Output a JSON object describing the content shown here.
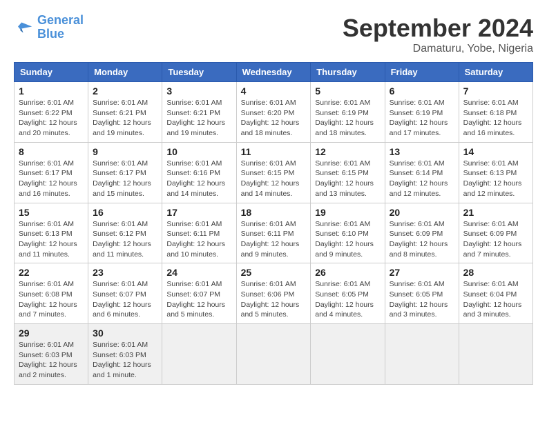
{
  "logo": {
    "line1": "General",
    "line2": "Blue"
  },
  "title": "September 2024",
  "subtitle": "Damaturu, Yobe, Nigeria",
  "weekdays": [
    "Sunday",
    "Monday",
    "Tuesday",
    "Wednesday",
    "Thursday",
    "Friday",
    "Saturday"
  ],
  "weeks": [
    [
      {
        "day": "1",
        "sunrise": "6:01 AM",
        "sunset": "6:22 PM",
        "daylight": "12 hours and 20 minutes."
      },
      {
        "day": "2",
        "sunrise": "6:01 AM",
        "sunset": "6:21 PM",
        "daylight": "12 hours and 19 minutes."
      },
      {
        "day": "3",
        "sunrise": "6:01 AM",
        "sunset": "6:21 PM",
        "daylight": "12 hours and 19 minutes."
      },
      {
        "day": "4",
        "sunrise": "6:01 AM",
        "sunset": "6:20 PM",
        "daylight": "12 hours and 18 minutes."
      },
      {
        "day": "5",
        "sunrise": "6:01 AM",
        "sunset": "6:19 PM",
        "daylight": "12 hours and 18 minutes."
      },
      {
        "day": "6",
        "sunrise": "6:01 AM",
        "sunset": "6:19 PM",
        "daylight": "12 hours and 17 minutes."
      },
      {
        "day": "7",
        "sunrise": "6:01 AM",
        "sunset": "6:18 PM",
        "daylight": "12 hours and 16 minutes."
      }
    ],
    [
      {
        "day": "8",
        "sunrise": "6:01 AM",
        "sunset": "6:17 PM",
        "daylight": "12 hours and 16 minutes."
      },
      {
        "day": "9",
        "sunrise": "6:01 AM",
        "sunset": "6:17 PM",
        "daylight": "12 hours and 15 minutes."
      },
      {
        "day": "10",
        "sunrise": "6:01 AM",
        "sunset": "6:16 PM",
        "daylight": "12 hours and 14 minutes."
      },
      {
        "day": "11",
        "sunrise": "6:01 AM",
        "sunset": "6:15 PM",
        "daylight": "12 hours and 14 minutes."
      },
      {
        "day": "12",
        "sunrise": "6:01 AM",
        "sunset": "6:15 PM",
        "daylight": "12 hours and 13 minutes."
      },
      {
        "day": "13",
        "sunrise": "6:01 AM",
        "sunset": "6:14 PM",
        "daylight": "12 hours and 12 minutes."
      },
      {
        "day": "14",
        "sunrise": "6:01 AM",
        "sunset": "6:13 PM",
        "daylight": "12 hours and 12 minutes."
      }
    ],
    [
      {
        "day": "15",
        "sunrise": "6:01 AM",
        "sunset": "6:13 PM",
        "daylight": "12 hours and 11 minutes."
      },
      {
        "day": "16",
        "sunrise": "6:01 AM",
        "sunset": "6:12 PM",
        "daylight": "12 hours and 11 minutes."
      },
      {
        "day": "17",
        "sunrise": "6:01 AM",
        "sunset": "6:11 PM",
        "daylight": "12 hours and 10 minutes."
      },
      {
        "day": "18",
        "sunrise": "6:01 AM",
        "sunset": "6:11 PM",
        "daylight": "12 hours and 9 minutes."
      },
      {
        "day": "19",
        "sunrise": "6:01 AM",
        "sunset": "6:10 PM",
        "daylight": "12 hours and 9 minutes."
      },
      {
        "day": "20",
        "sunrise": "6:01 AM",
        "sunset": "6:09 PM",
        "daylight": "12 hours and 8 minutes."
      },
      {
        "day": "21",
        "sunrise": "6:01 AM",
        "sunset": "6:09 PM",
        "daylight": "12 hours and 7 minutes."
      }
    ],
    [
      {
        "day": "22",
        "sunrise": "6:01 AM",
        "sunset": "6:08 PM",
        "daylight": "12 hours and 7 minutes."
      },
      {
        "day": "23",
        "sunrise": "6:01 AM",
        "sunset": "6:07 PM",
        "daylight": "12 hours and 6 minutes."
      },
      {
        "day": "24",
        "sunrise": "6:01 AM",
        "sunset": "6:07 PM",
        "daylight": "12 hours and 5 minutes."
      },
      {
        "day": "25",
        "sunrise": "6:01 AM",
        "sunset": "6:06 PM",
        "daylight": "12 hours and 5 minutes."
      },
      {
        "day": "26",
        "sunrise": "6:01 AM",
        "sunset": "6:05 PM",
        "daylight": "12 hours and 4 minutes."
      },
      {
        "day": "27",
        "sunrise": "6:01 AM",
        "sunset": "6:05 PM",
        "daylight": "12 hours and 3 minutes."
      },
      {
        "day": "28",
        "sunrise": "6:01 AM",
        "sunset": "6:04 PM",
        "daylight": "12 hours and 3 minutes."
      }
    ],
    [
      {
        "day": "29",
        "sunrise": "6:01 AM",
        "sunset": "6:03 PM",
        "daylight": "12 hours and 2 minutes."
      },
      {
        "day": "30",
        "sunrise": "6:01 AM",
        "sunset": "6:03 PM",
        "daylight": "12 hours and 1 minute."
      },
      null,
      null,
      null,
      null,
      null
    ]
  ]
}
